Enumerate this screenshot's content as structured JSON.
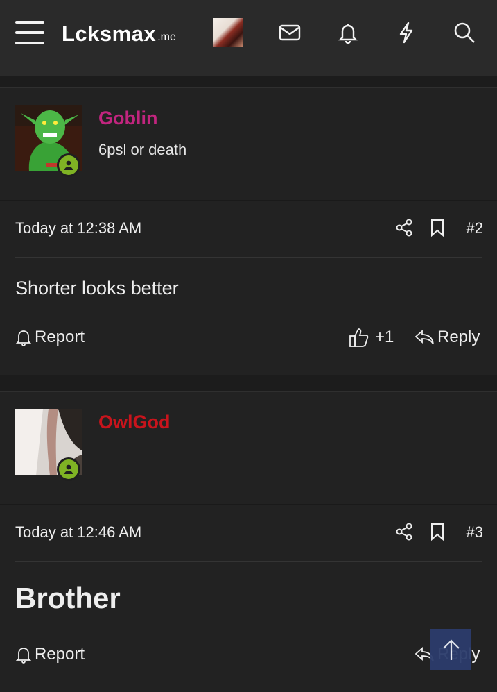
{
  "header": {
    "logo_text": "Lcksmax",
    "logo_tld": ".me",
    "icons": [
      "menu-icon",
      "inbox-icon",
      "bell-icon",
      "lightning-icon",
      "search-icon"
    ]
  },
  "posts": [
    {
      "username": "Goblin",
      "username_color": "#c2257f",
      "user_title": "6psl or death",
      "timestamp": "Today at 12:38 AM",
      "post_number": "#2",
      "body": "Shorter looks better",
      "report_label": "Report",
      "reaction_count": "+1",
      "reply_label": "Reply"
    },
    {
      "username": "OwlGod",
      "username_color": "#c8141c",
      "user_title": "",
      "timestamp": "Today at 12:46 AM",
      "post_number": "#3",
      "body": "Brother",
      "report_label": "Report",
      "reply_label": "Reply"
    }
  ],
  "status_color": "#7fb324"
}
